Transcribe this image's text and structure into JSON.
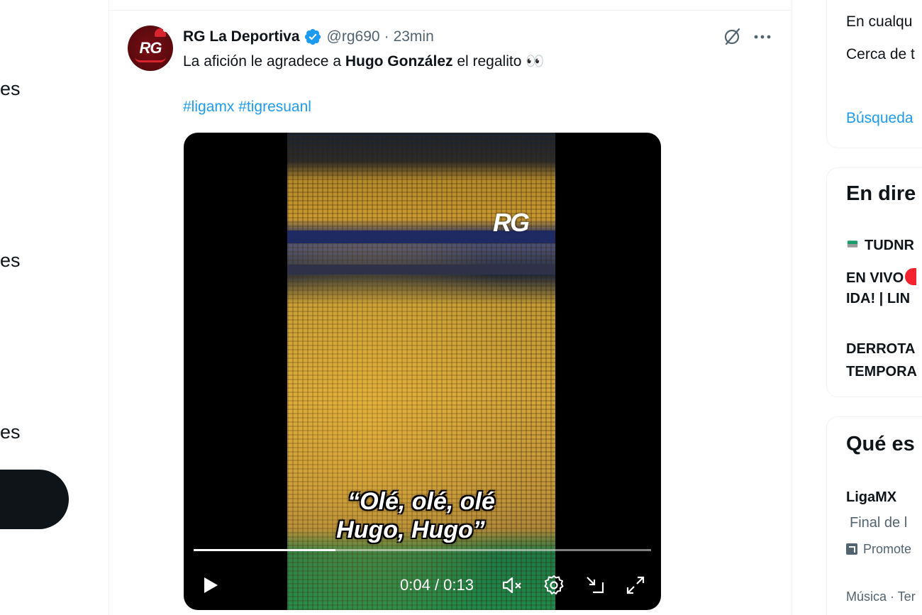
{
  "left_nav": {
    "fragments": [
      "es",
      "es",
      "es"
    ]
  },
  "tweet": {
    "display_name": "RG La Deportiva",
    "handle": "@rg690",
    "separator": "·",
    "time": "23min",
    "text_before": "La afición le agradece a ",
    "text_bold": "Hugo González",
    "text_after": " el regalito 👀",
    "hashtags": [
      "#ligamx",
      "#tigresuanl"
    ],
    "avatar_logo": "RG",
    "video": {
      "watermark": "RG",
      "caption_line1": "“Olé, olé, olé",
      "caption_line2": "Hugo, Hugo”",
      "timecode": "0:04 / 0:13",
      "progress": 0.31
    }
  },
  "right_sidebar": {
    "search_card": {
      "option1": "En cualqu",
      "option2": "Cerca de t",
      "advanced_link": "Búsqueda"
    },
    "live_card": {
      "title": "En dire",
      "channel": "TUDNR",
      "item1_line1": "EN VIVO",
      "item1_line2": "IDA! | LIN",
      "item2_line1": "DERROTA",
      "item2_line2": "TEMPORA"
    },
    "trend_card": {
      "title": "Qué es",
      "trend_name": "LigaMX",
      "trend_desc": "Final de l",
      "promoted": "Promote",
      "category": "Música · Ter"
    }
  },
  "colors": {
    "accent": "#1d9bf0",
    "text": "#0f1419",
    "muted": "#536471",
    "verified": "#1d9bf0",
    "live": "#f4212e"
  }
}
